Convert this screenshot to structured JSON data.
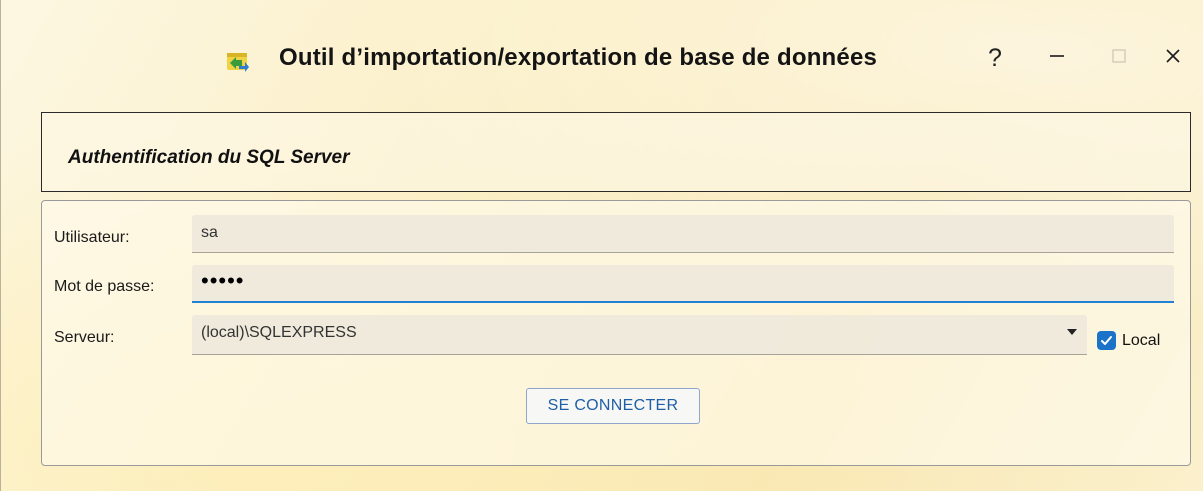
{
  "window": {
    "title": "Outil d’importation/exportation de base de données",
    "help_glyph": "?",
    "app_icon": "database-transfer-icon",
    "controls": [
      "minimize-icon",
      "maximize-icon",
      "close-icon"
    ]
  },
  "auth": {
    "title": "Authentification du SQL Server"
  },
  "form": {
    "user_label": "Utilisateur:",
    "user_value": "sa",
    "password_label": "Mot de passe:",
    "password_value": "•••••",
    "server_label": "Serveur:",
    "server_value": "(local)\\SQLEXPRESS",
    "local_label": "Local",
    "local_checked": true,
    "connect_label": "SE CONNECTER"
  },
  "colors": {
    "accent": "#1f82d4",
    "checkbox": "#1a73c9",
    "button_text": "#1f5fa8"
  }
}
